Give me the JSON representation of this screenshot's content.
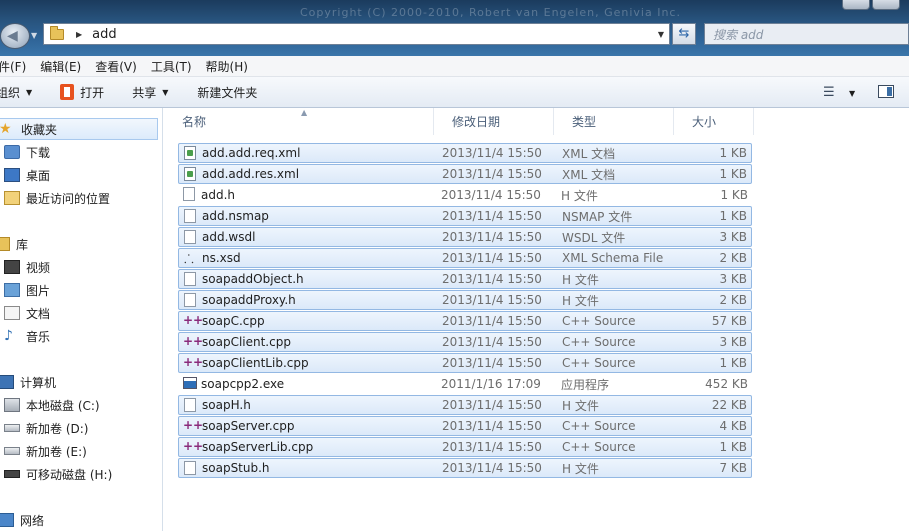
{
  "window": {
    "address_path": "add",
    "search_placeholder": "搜索 add",
    "background_title": "Copyright (C) 2000-2010, Robert van Engelen, Genivia Inc."
  },
  "menu": {
    "items": [
      "件(F)",
      "编辑(E)",
      "查看(V)",
      "工具(T)",
      "帮助(H)"
    ]
  },
  "toolbar": {
    "organize": "组织",
    "open": "打开",
    "share": "共享",
    "new_folder": "新建文件夹"
  },
  "sidebar": {
    "favorites": "收藏夹",
    "downloads": "下载",
    "desktop": "桌面",
    "recent": "最近访问的位置",
    "libraries": "库",
    "videos": "视频",
    "pictures": "图片",
    "documents": "文档",
    "music": "音乐",
    "computer": "计算机",
    "drive_c": "本地磁盘 (C:)",
    "drive_d": "新加卷 (D:)",
    "drive_e": "新加卷 (E:)",
    "drive_h": "可移动磁盘 (H:)",
    "network": "网络"
  },
  "columns": {
    "name": "名称",
    "date": "修改日期",
    "type": "类型",
    "size": "大小"
  },
  "files": [
    {
      "name": "add.add.req.xml",
      "date": "2013/11/4 15:50",
      "type": "XML 文档",
      "size": "1 KB",
      "icon": "xml-file-icon",
      "selected": true
    },
    {
      "name": "add.add.res.xml",
      "date": "2013/11/4 15:50",
      "type": "XML 文档",
      "size": "1 KB",
      "icon": "xml-file-icon",
      "selected": true
    },
    {
      "name": "add.h",
      "date": "2013/11/4 15:50",
      "type": "H 文件",
      "size": "1 KB",
      "icon": "file-icon",
      "selected": false
    },
    {
      "name": "add.nsmap",
      "date": "2013/11/4 15:50",
      "type": "NSMAP 文件",
      "size": "1 KB",
      "icon": "file-icon",
      "selected": true
    },
    {
      "name": "add.wsdl",
      "date": "2013/11/4 15:50",
      "type": "WSDL 文件",
      "size": "3 KB",
      "icon": "file-icon",
      "selected": true
    },
    {
      "name": "ns.xsd",
      "date": "2013/11/4 15:50",
      "type": "XML Schema File",
      "size": "2 KB",
      "icon": "xsd-file-icon",
      "selected": true
    },
    {
      "name": "soapaddObject.h",
      "date": "2013/11/4 15:50",
      "type": "H 文件",
      "size": "3 KB",
      "icon": "file-icon",
      "selected": true
    },
    {
      "name": "soapaddProxy.h",
      "date": "2013/11/4 15:50",
      "type": "H 文件",
      "size": "2 KB",
      "icon": "file-icon",
      "selected": true
    },
    {
      "name": "soapC.cpp",
      "date": "2013/11/4 15:50",
      "type": "C++ Source",
      "size": "57 KB",
      "icon": "cpp-file-icon",
      "selected": true
    },
    {
      "name": "soapClient.cpp",
      "date": "2013/11/4 15:50",
      "type": "C++ Source",
      "size": "3 KB",
      "icon": "cpp-file-icon",
      "selected": true
    },
    {
      "name": "soapClientLib.cpp",
      "date": "2013/11/4 15:50",
      "type": "C++ Source",
      "size": "1 KB",
      "icon": "cpp-file-icon",
      "selected": true
    },
    {
      "name": "soapcpp2.exe",
      "date": "2011/1/16 17:09",
      "type": "应用程序",
      "size": "452 KB",
      "icon": "exe-file-icon",
      "selected": false
    },
    {
      "name": "soapH.h",
      "date": "2013/11/4 15:50",
      "type": "H 文件",
      "size": "22 KB",
      "icon": "file-icon",
      "selected": true
    },
    {
      "name": "soapServer.cpp",
      "date": "2013/11/4 15:50",
      "type": "C++ Source",
      "size": "4 KB",
      "icon": "cpp-file-icon",
      "selected": true
    },
    {
      "name": "soapServerLib.cpp",
      "date": "2013/11/4 15:50",
      "type": "C++ Source",
      "size": "1 KB",
      "icon": "cpp-file-icon",
      "selected": true
    },
    {
      "name": "soapStub.h",
      "date": "2013/11/4 15:50",
      "type": "H 文件",
      "size": "7 KB",
      "icon": "file-icon",
      "selected": true
    }
  ]
}
